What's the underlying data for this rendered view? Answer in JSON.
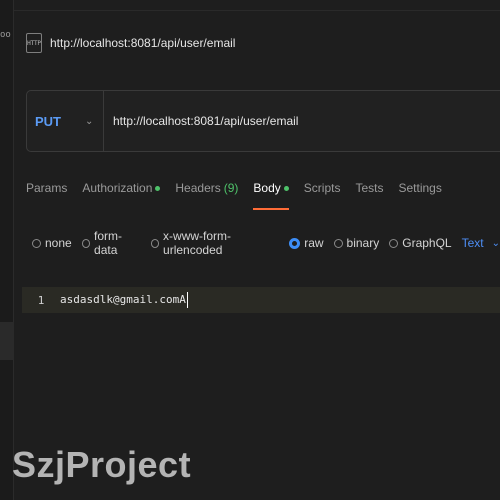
{
  "left_strip": {
    "glyph": "oo"
  },
  "request": {
    "icon_label": "HTTP",
    "title": "http://localhost:8081/api/user/email"
  },
  "url_bar": {
    "method": "PUT",
    "url": "http://localhost:8081/api/user/email"
  },
  "tabs": [
    {
      "label": "Params",
      "count": "",
      "dot": false,
      "active": false
    },
    {
      "label": "Authorization",
      "count": "",
      "dot": true,
      "active": false
    },
    {
      "label": "Headers",
      "count": "(9)",
      "dot": false,
      "active": false
    },
    {
      "label": "Body",
      "count": "",
      "dot": true,
      "active": true
    },
    {
      "label": "Scripts",
      "count": "",
      "dot": false,
      "active": false
    },
    {
      "label": "Tests",
      "count": "",
      "dot": false,
      "active": false
    },
    {
      "label": "Settings",
      "count": "",
      "dot": false,
      "active": false
    }
  ],
  "body_options": [
    {
      "label": "none",
      "checked": false
    },
    {
      "label": "form-data",
      "checked": false
    },
    {
      "label": "x-www-form-urlencoded",
      "checked": false
    },
    {
      "label": "raw",
      "checked": true
    },
    {
      "label": "binary",
      "checked": false
    },
    {
      "label": "GraphQL",
      "checked": false
    }
  ],
  "format": {
    "label": "Text"
  },
  "editor": {
    "line_number": "1",
    "content": "asdasdlk@gmail.comA"
  },
  "watermark": "SzjProject",
  "colors": {
    "accent_blue": "#5b9bf5",
    "active_underline": "#ff6c37",
    "status_green": "#4ec26a"
  }
}
